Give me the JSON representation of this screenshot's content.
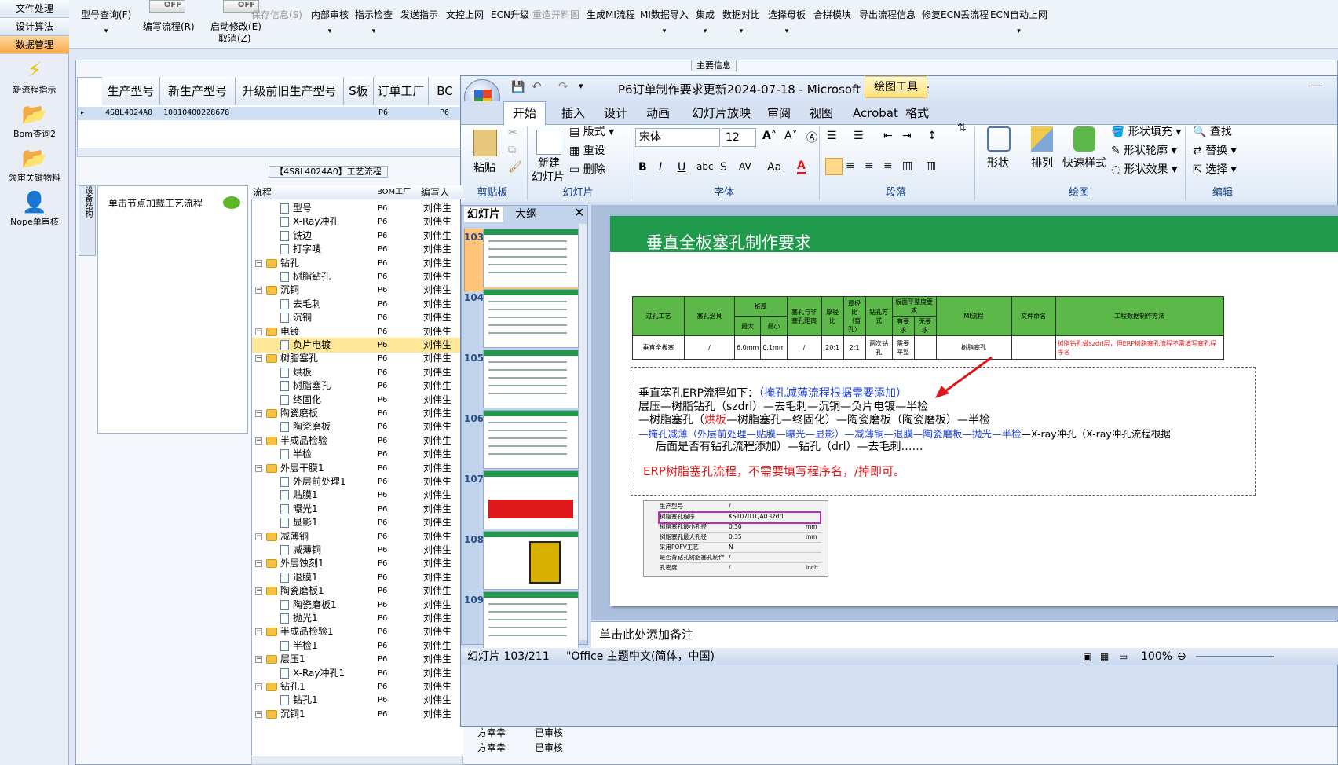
{
  "leftnav": {
    "buttons": [
      "文件处理",
      "设计算法",
      "数据管理"
    ],
    "items": [
      "新流程指示",
      "Bom查询2",
      "领审关键物料",
      "Nope单审核"
    ]
  },
  "toolbar": {
    "buttons": [
      {
        "label": "型号查询(F)",
        "disabled": false
      },
      {
        "label": "编写流程(R)",
        "disabled": false
      },
      {
        "label": "启动修改(E)",
        "disabled": false
      },
      {
        "label": "取消(Z)",
        "disabled": false
      },
      {
        "label": "保存信息(S)",
        "disabled": true
      },
      {
        "label": "内部审核",
        "disabled": false
      },
      {
        "label": "指示检查",
        "disabled": false
      },
      {
        "label": "发送指示",
        "disabled": false
      },
      {
        "label": "文控上网",
        "disabled": false
      },
      {
        "label": "ECN升级",
        "disabled": false
      },
      {
        "label": "重造开料图",
        "disabled": true
      },
      {
        "label": "生成MI流程",
        "disabled": false
      },
      {
        "label": "MI数据导入",
        "disabled": false
      },
      {
        "label": "集成",
        "disabled": false
      },
      {
        "label": "数据对比",
        "disabled": false
      },
      {
        "label": "选择母板",
        "disabled": false
      },
      {
        "label": "合拼模块",
        "disabled": false
      },
      {
        "label": "导出流程信息",
        "disabled": false
      },
      {
        "label": "修复ECN丢流程",
        "disabled": false
      },
      {
        "label": "ECN自动上网",
        "disabled": false
      }
    ],
    "switch_off": "OFF"
  },
  "main": {
    "section_title": "主要信息",
    "grid": {
      "headers": [
        "生产型号",
        "新生产型号",
        "升级前旧生产型号",
        "S板",
        "订单工厂",
        "BC"
      ],
      "row": [
        "4S8L4024A0",
        "10010400228678",
        "",
        "",
        "P6",
        "P6"
      ]
    },
    "process_title": "【4S8L4024A0】工艺流程",
    "side_tab": "设备结构",
    "hint": "单击节点加载工艺流程",
    "tree_headers": [
      "流程",
      "BOM工厂",
      "编写人"
    ],
    "tree": [
      {
        "label": "型号",
        "indent": 2,
        "type": "doc",
        "factory": "P6",
        "writer": "刘伟生"
      },
      {
        "label": "X-Ray冲孔",
        "indent": 2,
        "type": "doc",
        "factory": "P6",
        "writer": "刘伟生"
      },
      {
        "label": "铣边",
        "indent": 2,
        "type": "doc",
        "factory": "P6",
        "writer": "刘伟生"
      },
      {
        "label": "打字唛",
        "indent": 2,
        "type": "doc",
        "factory": "P6",
        "writer": "刘伟生"
      },
      {
        "label": "钻孔",
        "indent": 1,
        "type": "folder",
        "factory": "P6",
        "writer": "刘伟生"
      },
      {
        "label": "树脂钻孔",
        "indent": 2,
        "type": "doc",
        "factory": "P6",
        "writer": "刘伟生"
      },
      {
        "label": "沉铜",
        "indent": 1,
        "type": "folder",
        "factory": "P6",
        "writer": "刘伟生"
      },
      {
        "label": "去毛刺",
        "indent": 2,
        "type": "doc",
        "factory": "P6",
        "writer": "刘伟生"
      },
      {
        "label": "沉铜",
        "indent": 2,
        "type": "doc",
        "factory": "P6",
        "writer": "刘伟生"
      },
      {
        "label": "电镀",
        "indent": 1,
        "type": "folder",
        "factory": "P6",
        "writer": "刘伟生"
      },
      {
        "label": "负片电镀",
        "indent": 2,
        "type": "doc",
        "factory": "P6",
        "writer": "刘伟生",
        "selected": true
      },
      {
        "label": "树脂塞孔",
        "indent": 1,
        "type": "folder",
        "factory": "P6",
        "writer": "刘伟生"
      },
      {
        "label": "烘板",
        "indent": 2,
        "type": "doc",
        "factory": "P6",
        "writer": "刘伟生"
      },
      {
        "label": "树脂塞孔",
        "indent": 2,
        "type": "doc",
        "factory": "P6",
        "writer": "刘伟生"
      },
      {
        "label": "终固化",
        "indent": 2,
        "type": "doc",
        "factory": "P6",
        "writer": "刘伟生"
      },
      {
        "label": "陶瓷磨板",
        "indent": 1,
        "type": "folder",
        "factory": "P6",
        "writer": "刘伟生"
      },
      {
        "label": "陶瓷磨板",
        "indent": 2,
        "type": "doc",
        "factory": "P6",
        "writer": "刘伟生"
      },
      {
        "label": "半成品检验",
        "indent": 1,
        "type": "folder",
        "factory": "P6",
        "writer": "刘伟生"
      },
      {
        "label": "半检",
        "indent": 2,
        "type": "doc",
        "factory": "P6",
        "writer": "刘伟生"
      },
      {
        "label": "外层干膜1",
        "indent": 1,
        "type": "folder",
        "factory": "P6",
        "writer": "刘伟生"
      },
      {
        "label": "外层前处理1",
        "indent": 2,
        "type": "doc",
        "factory": "P6",
        "writer": "刘伟生"
      },
      {
        "label": "贴膜1",
        "indent": 2,
        "type": "doc",
        "factory": "P6",
        "writer": "刘伟生"
      },
      {
        "label": "曝光1",
        "indent": 2,
        "type": "doc",
        "factory": "P6",
        "writer": "刘伟生"
      },
      {
        "label": "显影1",
        "indent": 2,
        "type": "doc",
        "factory": "P6",
        "writer": "刘伟生"
      },
      {
        "label": "减薄铜",
        "indent": 1,
        "type": "folder",
        "factory": "P6",
        "writer": "刘伟生"
      },
      {
        "label": "减薄铜",
        "indent": 2,
        "type": "doc",
        "factory": "P6",
        "writer": "刘伟生"
      },
      {
        "label": "外层蚀刻1",
        "indent": 1,
        "type": "folder",
        "factory": "P6",
        "writer": "刘伟生"
      },
      {
        "label": "退膜1",
        "indent": 2,
        "type": "doc",
        "factory": "P6",
        "writer": "刘伟生"
      },
      {
        "label": "陶瓷磨板1",
        "indent": 1,
        "type": "folder",
        "factory": "P6",
        "writer": "刘伟生"
      },
      {
        "label": "陶瓷磨板1",
        "indent": 2,
        "type": "doc",
        "factory": "P6",
        "writer": "刘伟生"
      },
      {
        "label": "抛光1",
        "indent": 2,
        "type": "doc",
        "factory": "P6",
        "writer": "刘伟生"
      },
      {
        "label": "半成品检验1",
        "indent": 1,
        "type": "folder",
        "factory": "P6",
        "writer": "刘伟生"
      },
      {
        "label": "半检1",
        "indent": 2,
        "type": "doc",
        "factory": "P6",
        "writer": "刘伟生"
      },
      {
        "label": "层压1",
        "indent": 1,
        "type": "folder",
        "factory": "P6",
        "writer": "刘伟生"
      },
      {
        "label": "X-Ray冲孔1",
        "indent": 2,
        "type": "doc",
        "factory": "P6",
        "writer": "刘伟生"
      },
      {
        "label": "钻孔1",
        "indent": 1,
        "type": "folder",
        "factory": "P6",
        "writer": "刘伟生"
      },
      {
        "label": "钻孔1",
        "indent": 2,
        "type": "doc",
        "factory": "P6",
        "writer": "刘伟生"
      },
      {
        "label": "沉铜1",
        "indent": 1,
        "type": "folder",
        "factory": "P6",
        "writer": "刘伟生"
      }
    ],
    "extra": [
      {
        "name": "方幸幸",
        "status": "已审核"
      },
      {
        "name": "方幸幸",
        "status": "已审核"
      }
    ]
  },
  "ppt": {
    "title": "P6订单制作要求更新2024-07-18 - Microsoft PowerPoint",
    "context_tab": "绘图工具",
    "context_sub": "格式",
    "tabs": [
      "开始",
      "插入",
      "设计",
      "动画",
      "幻灯片放映",
      "审阅",
      "视图",
      "Acrobat"
    ],
    "ribbon": {
      "clipboard": {
        "label": "剪贴板",
        "paste": "粘贴"
      },
      "slides": {
        "label": "幻灯片",
        "new": "新建",
        "new2": "幻灯片",
        "layout": "版式",
        "reset": "重设",
        "delete": "删除"
      },
      "font": {
        "label": "字体",
        "name": "宋体",
        "size": "12"
      },
      "paragraph": {
        "label": "段落"
      },
      "drawing": {
        "label": "绘图",
        "shape": "形状",
        "arrange": "排列",
        "quick": "快速样式",
        "fill": "形状填充",
        "outline": "形状轮廓",
        "effect": "形状效果"
      },
      "edit": {
        "label": "编辑",
        "find": "查找",
        "replace": "替换",
        "select": "选择"
      }
    },
    "panel_tabs": [
      "幻灯片",
      "大纲"
    ],
    "slide_numbers": [
      "103",
      "104",
      "105",
      "106",
      "107",
      "108",
      "109"
    ],
    "slide": {
      "title": "垂直全板塞孔制作要求",
      "table": {
        "headers": [
          "过孔工艺",
          "塞孔治具",
          "板厚",
          "塞孔与非塞孔距离",
          "厚径比",
          "厚径比（盲孔）",
          "钻孔方式",
          "板面平整度要求",
          "MI流程",
          "文件命名",
          "工程数据制作方法"
        ],
        "sub": [
          "最大",
          "最小",
          "有要求",
          "无要求"
        ],
        "row": [
          "垂直全板塞",
          "/",
          "6.0mm",
          "0.1mm",
          "/",
          "20:1",
          "2:1",
          "两次钻孔",
          "需要平整",
          "树脂塞孔"
        ],
        "method": "树脂钻孔做szdrl层，但ERP树脂塞孔流程不需填写塞孔程序名"
      },
      "body": {
        "l1a": "垂直塞孔ERP流程如下：",
        "l1b": "（掩孔减薄流程根据需要添加）",
        "l2": "层压—树脂钻孔（szdrl）—去毛刺—沉铜—负片电镀—半检",
        "l3a": "—树脂塞孔（",
        "l3b": "烘板",
        "l3c": "—树脂塞孔—终固化）—陶瓷磨板（陶瓷磨板）—半检",
        "l4a": "—掩孔减薄（外层前处理—贴膜—曝光—显影）—减薄铜—退膜—陶瓷磨板—抛光—半检",
        "l4b": "—X-ray冲孔（X-ray冲孔流程根据",
        "l5": "后面是否有钻孔流程添加）—钻孔（drl）—去毛刺……",
        "red": "ERP树脂塞孔流程，不需要填写程序名，/掉即可。"
      },
      "form": [
        [
          "生产型号",
          "/",
          ""
        ],
        [
          "树脂塞孔程序",
          "KS10701QA0.szdrl",
          ""
        ],
        [
          "树脂塞孔最小孔径",
          "0.30",
          "mm"
        ],
        [
          "树脂塞孔最大孔径",
          "0.35",
          "mm"
        ],
        [
          "采用POFV工艺",
          "N",
          ""
        ],
        [
          "是否背钻孔树脂塞孔制作",
          "/",
          ""
        ],
        [
          "孔密度",
          "/",
          "inch"
        ]
      ]
    },
    "notes": "单击此处添加备注",
    "status": {
      "slide": "幻灯片 103/211",
      "theme": "\"Office 主题\"",
      "lang": "中文(简体，中国)",
      "zoom": "100%"
    }
  },
  "colors": {
    "slide_header": "#1f9a4a",
    "table_head": "#5cb848",
    "accent_orange": "#f7a94a",
    "red": "#e0171c",
    "blue": "#1a3ed6"
  }
}
